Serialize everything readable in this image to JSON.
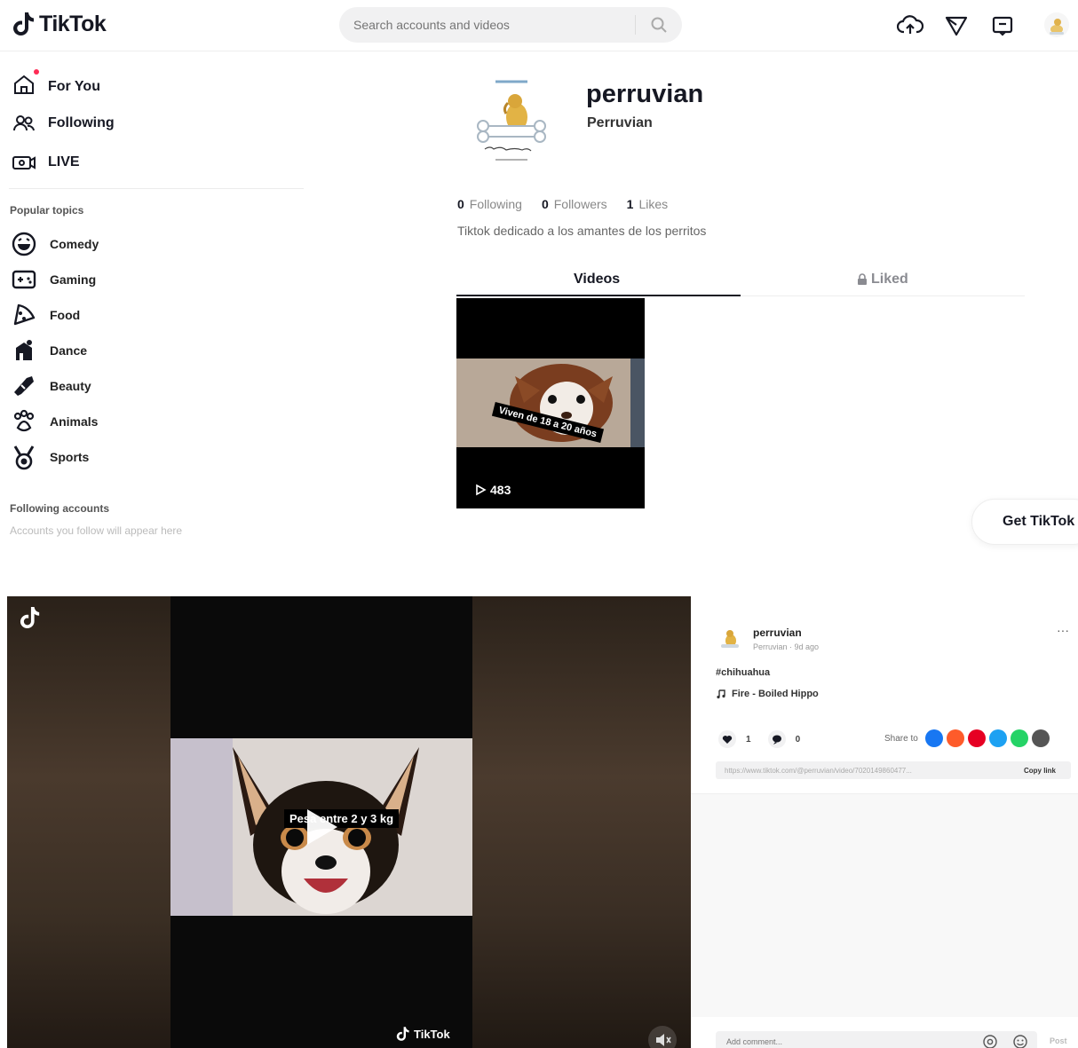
{
  "top": {
    "brand": "TikTok",
    "search": {
      "placeholder": "Search accounts and videos"
    },
    "nav": [
      {
        "label": "For You",
        "icon": "home-icon"
      },
      {
        "label": "Following",
        "icon": "following-icon"
      },
      {
        "label": "LIVE",
        "icon": "live-icon"
      }
    ],
    "popular_topics_label": "Popular topics",
    "topics": [
      {
        "label": "Comedy",
        "icon": "comedy-icon"
      },
      {
        "label": "Gaming",
        "icon": "gaming-icon"
      },
      {
        "label": "Food",
        "icon": "food-icon"
      },
      {
        "label": "Dance",
        "icon": "dance-icon"
      },
      {
        "label": "Beauty",
        "icon": "beauty-icon"
      },
      {
        "label": "Animals",
        "icon": "animals-icon"
      },
      {
        "label": "Sports",
        "icon": "sports-icon"
      }
    ],
    "following_accounts_label": "Following accounts",
    "following_accounts_hint": "Accounts you follow will appear here",
    "profile": {
      "handle": "perruvian",
      "display_name": "Perruvian",
      "stats": {
        "following_count": "0",
        "following_label": "Following",
        "followers_count": "0",
        "followers_label": "Followers",
        "likes_count": "1",
        "likes_label": "Likes"
      },
      "bio": "Tiktok dedicado a los amantes de los perritos",
      "tabs": {
        "videos": "Videos",
        "liked": "Liked"
      },
      "video": {
        "overlay_text": "Viven de 18 a 20 años",
        "views": "483"
      }
    },
    "get_app": "Get TikTok App",
    "colors": {
      "accent": "#fe2c55",
      "text": "#161823"
    }
  },
  "bottom": {
    "video": {
      "caption": "Pesa entre 2 y 3 kg",
      "watermark": "TikTok"
    },
    "post": {
      "username": "perruvian",
      "subline": "Perruvian · 9d ago",
      "more": "···",
      "hashtag": "#chihuahua",
      "music": "Fire - Boiled Hippo",
      "likes": "1",
      "comments": "0",
      "share_label": "Share to",
      "link": "https://www.tiktok.com/@perruvian/video/7020149860477...",
      "copy_link": "Copy link",
      "comment_placeholder": "Add comment...",
      "post_label": "Post"
    }
  }
}
